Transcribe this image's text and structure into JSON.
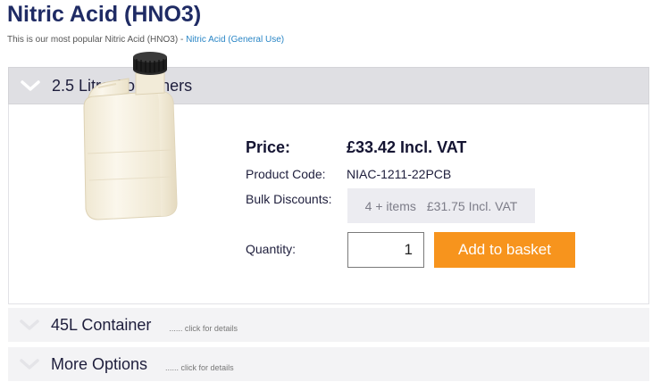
{
  "header": {
    "title": "Nitric Acid (HNO3)",
    "subtitle": "This is our most popular Nitric Acid (HNO3) - ",
    "subtitle_link": "Nitric Acid (General Use)"
  },
  "sections": [
    {
      "label": "2.5 Litre Containers",
      "expanded": true,
      "chevron_icon": "chevron-down-icon"
    },
    {
      "label": "45L Container",
      "hint": "...... click for details",
      "expanded": false,
      "chevron_icon": "chevron-down-icon"
    },
    {
      "label": "More Options",
      "hint": "...... click for details",
      "expanded": false,
      "chevron_icon": "chevron-down-icon"
    }
  ],
  "product": {
    "image": "white-jerrycan-with-black-cap",
    "price_label": "Price:",
    "price_value": "£33.42 Incl. VAT",
    "code_label": "Product Code:",
    "code_value": "NIAC-1211-22PCB",
    "bulk_label": "Bulk Discounts:",
    "bulk_qty": "4 + items",
    "bulk_price": "£31.75 Incl. VAT",
    "quantity_label": "Quantity:",
    "quantity_value": "1",
    "add_button": "Add to basket"
  },
  "colors": {
    "title": "#1f2b64",
    "link": "#2a86c6",
    "button": "#f7941d",
    "open_header_bg": "#dfdfe3",
    "closed_header_bg": "#f3f3f5"
  }
}
